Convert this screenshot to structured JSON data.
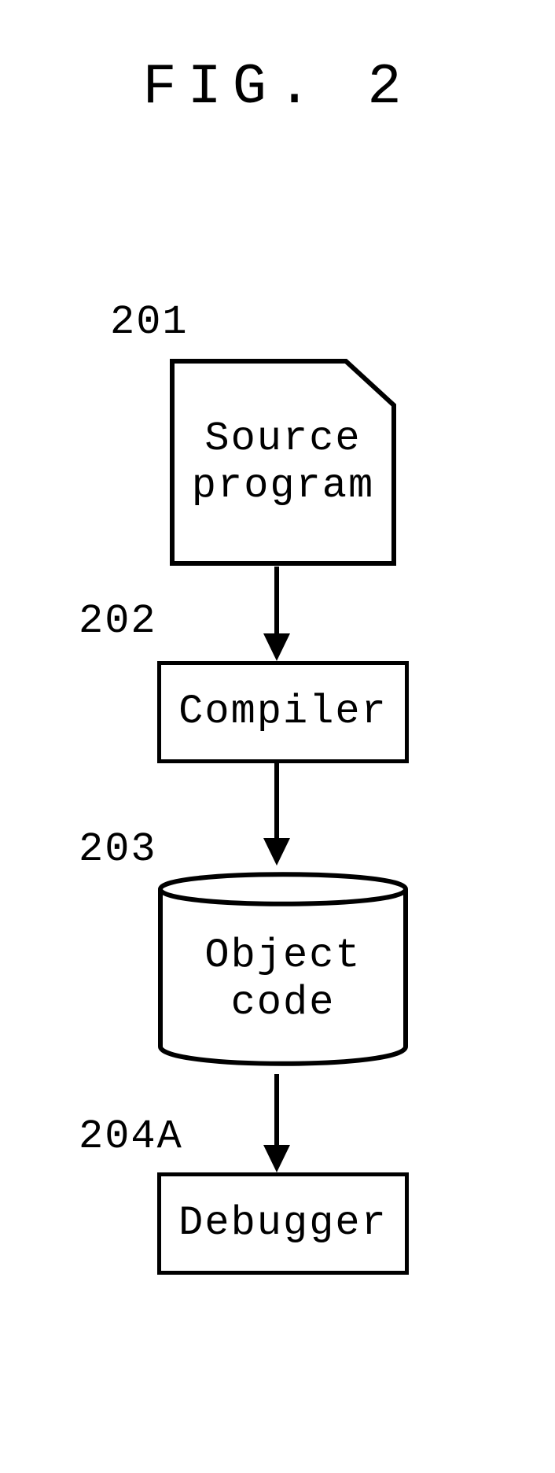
{
  "title": "FIG. 2",
  "labels": {
    "n201": "201",
    "n202": "202",
    "n203": "203",
    "n204a": "204A"
  },
  "nodes": {
    "source_program_l1": "Source",
    "source_program_l2": "program",
    "compiler": "Compiler",
    "object_code_l1": "Object",
    "object_code_l2": "code",
    "debugger": "Debugger"
  },
  "chart_data": {
    "type": "flowchart",
    "title": "FIG. 2",
    "nodes": [
      {
        "id": "201",
        "label": "Source program",
        "shape": "document"
      },
      {
        "id": "202",
        "label": "Compiler",
        "shape": "process"
      },
      {
        "id": "203",
        "label": "Object code",
        "shape": "database"
      },
      {
        "id": "204A",
        "label": "Debugger",
        "shape": "process"
      }
    ],
    "edges": [
      {
        "from": "201",
        "to": "202"
      },
      {
        "from": "202",
        "to": "203"
      },
      {
        "from": "203",
        "to": "204A"
      }
    ]
  }
}
